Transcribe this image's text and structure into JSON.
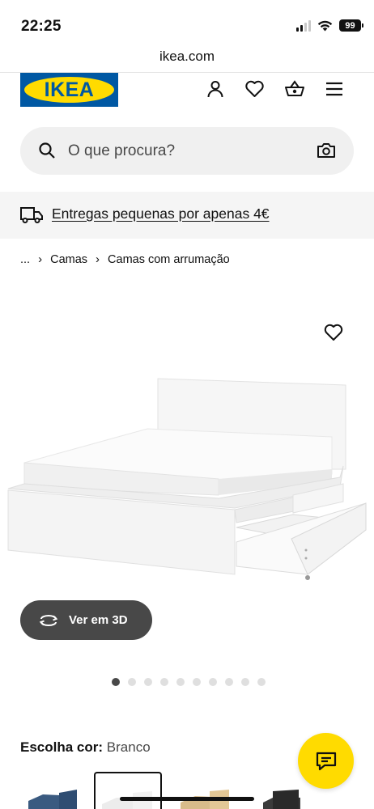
{
  "status_bar": {
    "time": "22:25",
    "battery": "99"
  },
  "browser": {
    "url": "ikea.com"
  },
  "brand": {
    "logo_text": "IKEA",
    "logo_blue": "#0058a3",
    "logo_yellow": "#ffdb00"
  },
  "header": {
    "icons": [
      "account-icon",
      "heart-icon",
      "basket-icon",
      "menu-icon"
    ]
  },
  "search": {
    "placeholder": "O que procura?"
  },
  "banner": {
    "text": "Entregas pequenas por apenas 4€"
  },
  "breadcrumb": {
    "ellipsis": "...",
    "items": [
      "Camas",
      "Camas com arrumação"
    ]
  },
  "product": {
    "view3d_label": "Ver em 3D",
    "gallery": {
      "total": 10,
      "active_index": 0
    },
    "color_label": "Escolha cor:",
    "color_value": "Branco",
    "swatches": [
      "azul",
      "branco",
      "carvalho",
      "preto"
    ]
  },
  "colors": {
    "accent_yellow": "#ffdb00",
    "dark_button": "#484848"
  }
}
